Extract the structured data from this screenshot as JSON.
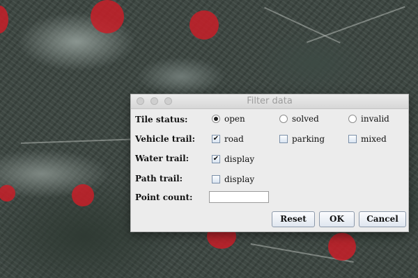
{
  "dialog": {
    "title": "Filter data",
    "rows": {
      "tile_status": {
        "label": "Tile status:",
        "options": [
          {
            "label": "open",
            "selected": true
          },
          {
            "label": "solved",
            "selected": false
          },
          {
            "label": "invalid",
            "selected": false
          }
        ]
      },
      "vehicle_trail": {
        "label": "Vehicle trail:",
        "options": [
          {
            "label": "road",
            "checked": true
          },
          {
            "label": "parking",
            "checked": false
          },
          {
            "label": "mixed",
            "checked": false
          }
        ]
      },
      "water_trail": {
        "label": "Water trail:",
        "options": [
          {
            "label": "display",
            "checked": true
          }
        ]
      },
      "path_trail": {
        "label": "Path trail:",
        "options": [
          {
            "label": "display",
            "checked": false
          }
        ]
      },
      "point_count": {
        "label": "Point count:",
        "value": ""
      }
    },
    "buttons": {
      "reset": "Reset",
      "ok": "OK",
      "cancel": "Cancel"
    }
  },
  "map": {
    "marker_color": "#c81e28"
  }
}
